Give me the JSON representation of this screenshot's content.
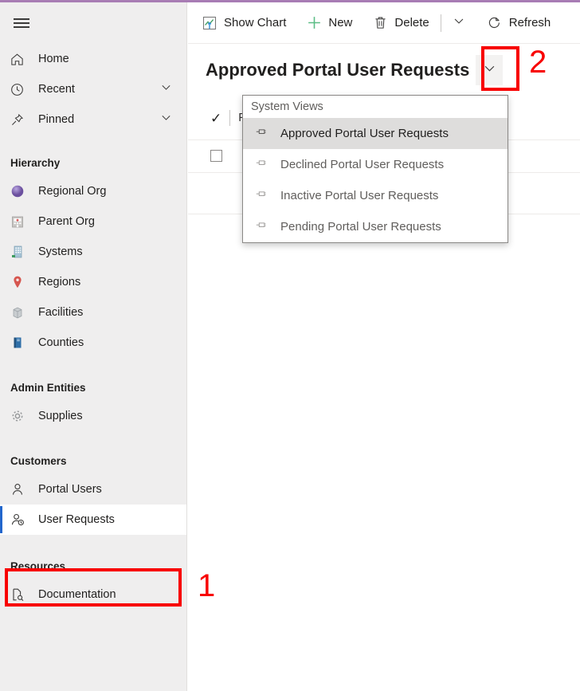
{
  "theme": {
    "accent_strip": "#a87cb4",
    "sidebar_bg": "#efeeee",
    "selected_indicator": "#2266cc",
    "annotation_color": "#f80000",
    "new_icon_color": "#4caf76"
  },
  "sidebar": {
    "menu_button": "menu",
    "top_items": [
      {
        "label": "Home",
        "icon": "home-icon",
        "expandable": false
      },
      {
        "label": "Recent",
        "icon": "clock-icon",
        "expandable": true
      },
      {
        "label": "Pinned",
        "icon": "pin-icon",
        "expandable": true
      }
    ],
    "groups": [
      {
        "title": "Hierarchy",
        "items": [
          {
            "label": "Regional Org",
            "icon": "globe-sphere-icon"
          },
          {
            "label": "Parent Org",
            "icon": "hospital-building-icon"
          },
          {
            "label": "Systems",
            "icon": "office-building-icon"
          },
          {
            "label": "Regions",
            "icon": "map-pin-icon"
          },
          {
            "label": "Facilities",
            "icon": "facility-cube-icon"
          },
          {
            "label": "Counties",
            "icon": "book-icon"
          }
        ]
      },
      {
        "title": "Admin Entities",
        "items": [
          {
            "label": "Supplies",
            "icon": "gear-icon"
          }
        ]
      },
      {
        "title": "Customers",
        "items": [
          {
            "label": "Portal Users",
            "icon": "person-icon"
          },
          {
            "label": "User Requests",
            "icon": "person-clock-icon",
            "selected": true
          }
        ]
      },
      {
        "title": "Resources",
        "items": [
          {
            "label": "Documentation",
            "icon": "document-search-icon"
          }
        ]
      }
    ]
  },
  "command_bar": {
    "buttons": [
      {
        "label": "Show Chart",
        "icon": "show-chart-icon"
      },
      {
        "label": "New",
        "icon": "plus-icon"
      },
      {
        "label": "Delete",
        "icon": "trash-icon"
      }
    ],
    "overflow_icon": "chevron-down-icon",
    "refresh": {
      "label": "Refresh",
      "icon": "refresh-icon"
    }
  },
  "title_row": {
    "title": "Approved Portal User Requests",
    "switch_icon": "chevron-down-icon"
  },
  "subheader": {
    "check_glyph": "✓",
    "label": "Filter by keyword"
  },
  "view_dropdown": {
    "header": "System Views",
    "items": [
      {
        "label": "Approved Portal User Requests",
        "icon": "pin-icon",
        "selected": true
      },
      {
        "label": "Declined Portal User Requests",
        "icon": "pin-icon",
        "selected": false
      },
      {
        "label": "Inactive Portal User Requests",
        "icon": "pin-icon",
        "selected": false
      },
      {
        "label": "Pending Portal User Requests",
        "icon": "pin-icon",
        "selected": false
      }
    ]
  },
  "annotations": [
    {
      "number": "1",
      "target": "User Requests sidebar item"
    },
    {
      "number": "2",
      "target": "View switcher chevron"
    }
  ]
}
